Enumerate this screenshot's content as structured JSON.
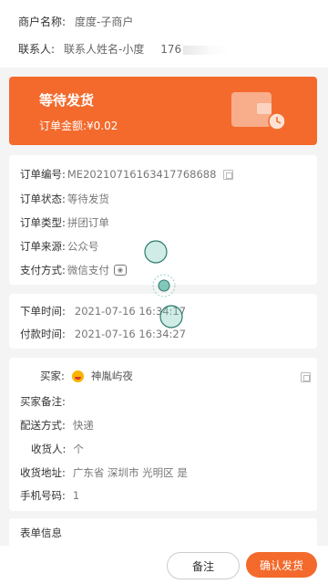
{
  "merchant": {
    "name_label": "商户名称:",
    "name_value": "度度-子商户",
    "contact_label": "联系人:",
    "contact_value": "联系人姓名-小度",
    "phone_prefix": "176"
  },
  "status": {
    "title": "等待发货",
    "amount": "订单金额:¥0.02",
    "accent_color": "#f36a2c"
  },
  "order_info": {
    "number_label": "订单编号:",
    "number_value": "ME20210716163417768688",
    "status_label": "订单状态:",
    "status_value": "等待发货",
    "type_label": "订单类型:",
    "type_value": "拼团订单",
    "source_label": "订单来源:",
    "source_value": "公众号",
    "pay_label": "支付方式:",
    "pay_value": "微信支付"
  },
  "time_info": {
    "order_time_label": "下单时间:",
    "order_time_value": "2021-07-16 16:34:17",
    "pay_time_label": "付款时间:",
    "pay_time_value": "2021-07-16 16:34:27"
  },
  "buyer_info": {
    "buyer_label": "买家:",
    "buyer_value": "神胤屿夜",
    "remark_label": "买家备注:",
    "delivery_label": "配送方式:",
    "delivery_value": "快递",
    "receiver_label": "收货人:",
    "receiver_value": "个",
    "address_label": "收货地址:",
    "address_value": "广东省 深圳市 光明区 是",
    "phone_label": "手机号码:",
    "phone_value": "1"
  },
  "form_info": {
    "title": "表单信息"
  },
  "actions": {
    "note_label": "备注",
    "ship_label": "确认发货"
  }
}
